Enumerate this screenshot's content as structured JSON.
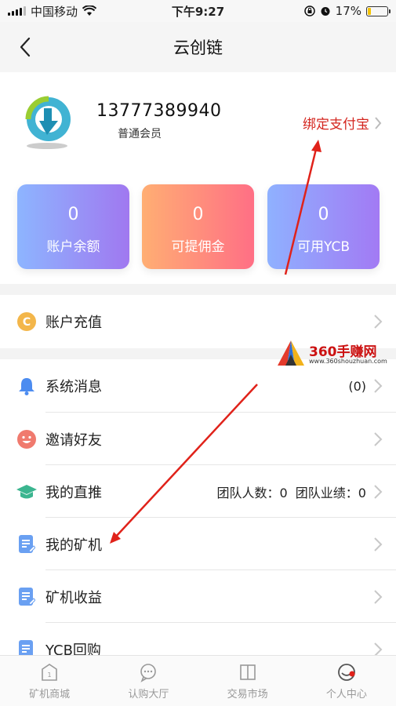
{
  "status_bar": {
    "carrier": "中国移动",
    "time": "下午9:27",
    "battery": "17%",
    "battery_level": 0.17
  },
  "nav": {
    "title": "云创链"
  },
  "profile": {
    "phone": "13777389940",
    "member_level": "普通会员",
    "bind_alipay": "绑定支付宝"
  },
  "cards": [
    {
      "value": "0",
      "label": "账户余额"
    },
    {
      "value": "0",
      "label": "可提佣金"
    },
    {
      "value": "0",
      "label": "可用YCB"
    }
  ],
  "menu": {
    "recharge": {
      "label": "账户充值",
      "icon": "coin-icon"
    },
    "messages": {
      "label": "系统消息",
      "value": "(0)",
      "icon": "bell-icon"
    },
    "invite": {
      "label": "邀请好友",
      "icon": "smile-icon"
    },
    "direct": {
      "label": "我的直推",
      "value": "团队人数：0  团队业绩：0",
      "icon": "graduation-cap-icon"
    },
    "miners": {
      "label": "我的矿机",
      "icon": "document-icon"
    },
    "earnings": {
      "label": "矿机收益",
      "icon": "document-icon"
    },
    "buyback": {
      "label": "YCB回购",
      "icon": "document-icon"
    }
  },
  "watermark": {
    "text": "360手赚网",
    "url": "www.360shouzhuan.com"
  },
  "tabbar": [
    {
      "label": "矿机商城",
      "icon": "shop-icon"
    },
    {
      "label": "认购大厅",
      "icon": "chat-icon"
    },
    {
      "label": "交易市场",
      "icon": "book-icon"
    },
    {
      "label": "个人中心",
      "icon": "user-icon"
    }
  ],
  "colors": {
    "accent_red": "#d4261f",
    "card_blue": "#8db5ff",
    "card_purple": "#a078f0",
    "card_orange": "#ffae73",
    "card_pink": "#ff6f85"
  }
}
